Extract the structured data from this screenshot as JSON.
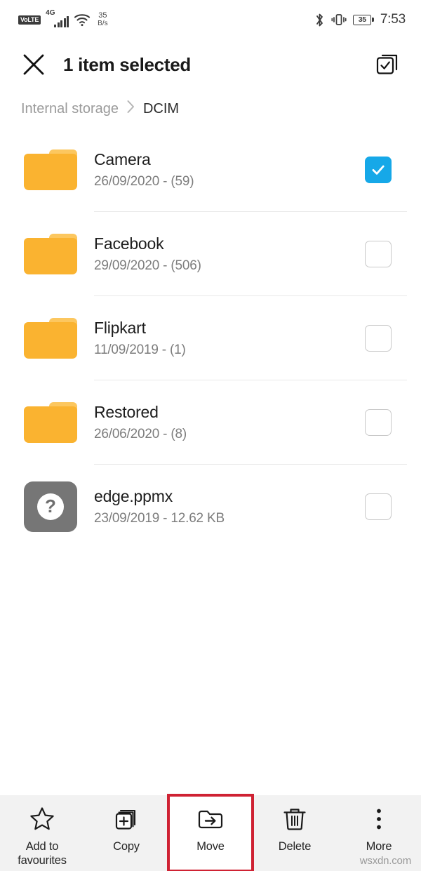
{
  "status_bar": {
    "volte_label": "VoLTE",
    "network_type": "4G",
    "signal_bars": 5,
    "wifi_icon": "wifi-icon",
    "network_speed_value": "35",
    "network_speed_unit": "B/s",
    "bluetooth_icon": "bluetooth-icon",
    "vibrate_icon": "vibrate-icon",
    "battery_level": "35",
    "time": "7:53"
  },
  "header": {
    "close_icon": "close-icon",
    "title": "1 item selected",
    "select_all_icon": "select-all-icon"
  },
  "breadcrumb": {
    "root": "Internal storage",
    "separator": "›",
    "current": "DCIM"
  },
  "files": [
    {
      "name": "Camera",
      "meta": "26/09/2020 - (59)",
      "icon": "folder-icon",
      "type": "folder",
      "selected": true
    },
    {
      "name": "Facebook",
      "meta": "29/09/2020 - (506)",
      "icon": "folder-icon",
      "type": "folder",
      "selected": false
    },
    {
      "name": "Flipkart",
      "meta": "11/09/2019 - (1)",
      "icon": "folder-icon",
      "type": "folder",
      "selected": false
    },
    {
      "name": "Restored",
      "meta": "26/06/2020 - (8)",
      "icon": "folder-icon",
      "type": "folder",
      "selected": false
    },
    {
      "name": "edge.ppmx",
      "meta": "23/09/2019 - 12.62 KB",
      "icon": "unknown-file-icon",
      "type": "file",
      "selected": false
    }
  ],
  "toolbar": {
    "items": [
      {
        "label": "Add to\nfavourites",
        "icon": "star-icon",
        "highlighted": false
      },
      {
        "label": "Copy",
        "icon": "copy-icon",
        "highlighted": false
      },
      {
        "label": "Move",
        "icon": "move-folder-icon",
        "highlighted": true
      },
      {
        "label": "Delete",
        "icon": "trash-icon",
        "highlighted": false
      },
      {
        "label": "More",
        "icon": "more-vertical-icon",
        "highlighted": false
      }
    ]
  },
  "watermark": "wsxdn.com",
  "colors": {
    "accent_checked": "#16a8e8",
    "folder": "#fab330",
    "highlight_outline": "#cf2233",
    "toolbar_bg": "#f2f2f2"
  }
}
